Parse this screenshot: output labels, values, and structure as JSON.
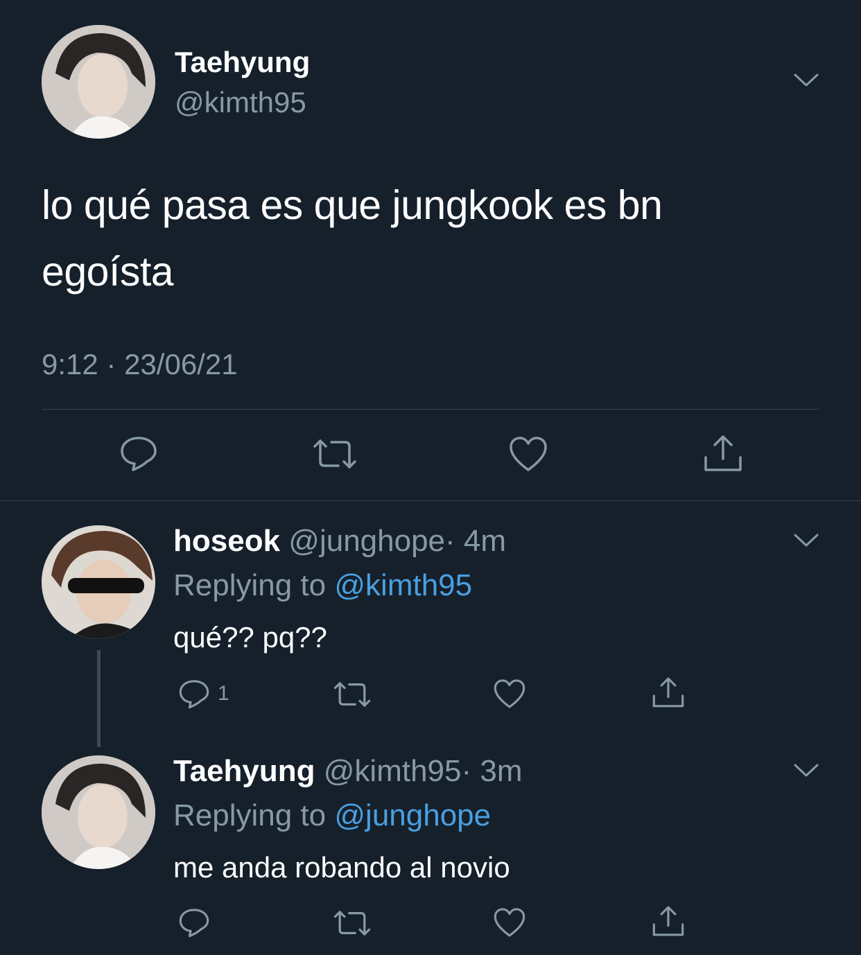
{
  "main_tweet": {
    "display_name": "Taehyung",
    "handle": "@kimth95",
    "text_line1": "lo qué pasa es que jungkook es bn",
    "text_line2": "egoísta",
    "timestamp": "9:12 · 23/06/21",
    "avatar": "avatar-taehyung"
  },
  "reply1": {
    "display_name": "hoseok",
    "handle": "@junghope",
    "time": "· 4m",
    "replying_prefix": "Replying to",
    "replying_handle": "@kimth95",
    "text": "qué?? pq??",
    "reply_count": "1",
    "avatar": "avatar-hoseok"
  },
  "reply2": {
    "display_name": "Taehyung",
    "handle": "@kimth95",
    "time": "· 3m",
    "replying_prefix": "Replying to",
    "replying_handle": "@junghope",
    "text": "me anda robando al novio",
    "avatar": "avatar-taehyung"
  },
  "icons": {
    "reply": "reply-icon",
    "retweet": "retweet-icon",
    "like": "like-icon",
    "share": "share-icon",
    "more": "chevron-down-icon"
  },
  "colors": {
    "background": "#15202b",
    "text": "#ffffff",
    "muted": "#8899a6",
    "link": "#4a9fe0",
    "divider": "#38444d"
  }
}
